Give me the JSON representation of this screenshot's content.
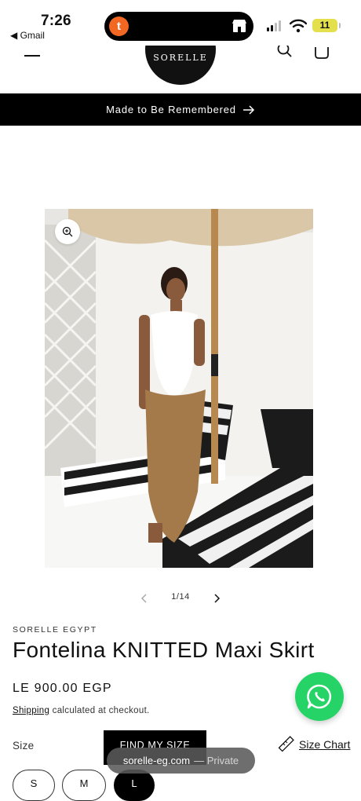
{
  "status_bar": {
    "time": "7:26",
    "back_app": "◀ Gmail",
    "island_app_letter": "t",
    "battery": "11"
  },
  "header": {
    "logo_text": "SORELLE",
    "icons": [
      "menu-icon",
      "search-icon",
      "cart-icon"
    ]
  },
  "announcement": {
    "text": "Made to Be Remembered"
  },
  "media": {
    "pagination": "1/14"
  },
  "product": {
    "vendor": "SORELLE EGYPT",
    "title": "Fontelina KNITTED Maxi Skirt",
    "price": "LE 900.00 EGP",
    "shipping_link": "Shipping",
    "shipping_text": " calculated at checkout."
  },
  "size": {
    "label": "Size",
    "find_my_size": "FIND MY SIZE",
    "size_chart": "Size Chart",
    "options": [
      "S",
      "M",
      "L"
    ],
    "selected": "L"
  },
  "browser": {
    "domain": "sorelle-eg.com",
    "mode": "— Private"
  },
  "colors": {
    "accent_black": "#000000",
    "whatsapp_green": "#25d366",
    "battery_yellow": "#e3df4d",
    "temu_orange": "#f26722"
  }
}
